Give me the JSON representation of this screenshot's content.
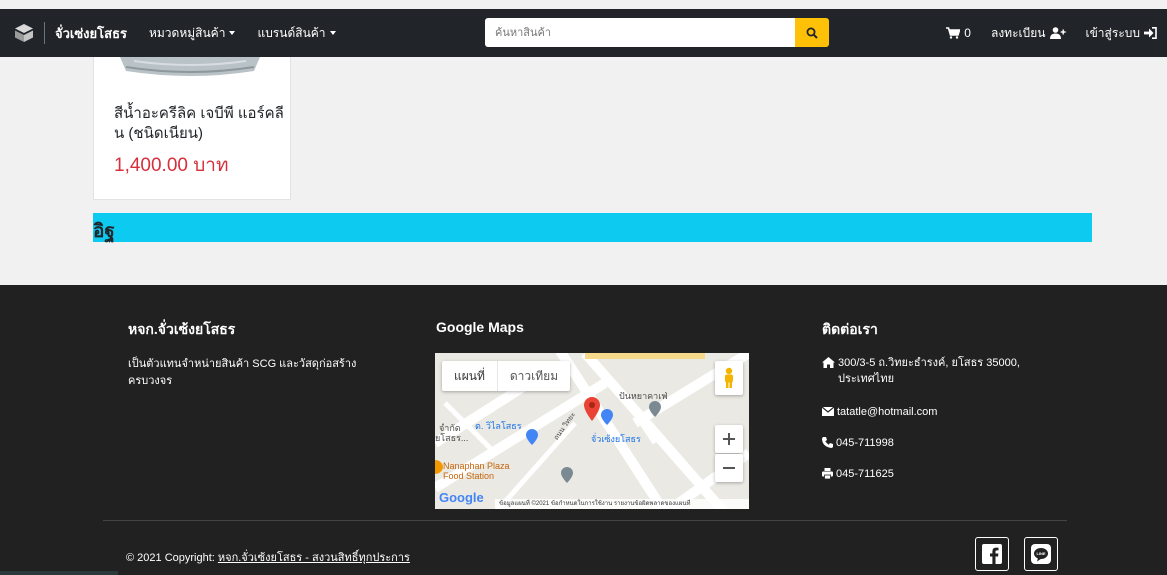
{
  "navbar": {
    "brand": "จั่วเซ่งยโสธร",
    "categories_label": "หมวดหมู่สินค้า",
    "brands_label": "แบรนด์สินค้า",
    "search_placeholder": "ค้นหาสินค้า",
    "cart_count": "0",
    "register_label": "ลงทะเบียน",
    "login_label": "เข้าสู่ระบบ"
  },
  "product": {
    "title": "สีน้ำอะครีลิค เจบีพี แอร์คลีน (ชนิดเนียน)",
    "price": "1,400.00 บาท"
  },
  "category": {
    "title": "อิฐ"
  },
  "footer": {
    "about": {
      "heading": "หจก.จั่วเซ้งยโสธร",
      "text": "เป็นตัวแทนจำหน่ายสินค้า SCG และวัสดุก่อสร้างครบวงจร"
    },
    "maps": {
      "heading": "Google Maps",
      "tab_map": "แผนที่",
      "tab_satellite": "ดาวเทียม",
      "labels": {
        "cafe": "ปันหยาคาเฟ่",
        "school": "ต. วิไลโสธร",
        "shop": "จั่วเซ้งยโสธร",
        "plaza_1": "Nanaphan Plaza",
        "plaza_2": "Food Station",
        "left_1": "จำกัด",
        "left_2": "ยโสธร...",
        "road": "ถนน วิทยะ",
        "google": "Google",
        "attribution": "ข้อมูลแผนที่ ©2021   ข้อกำหนดในการใช้งาน   รายงานข้อผิดพลาดของแผนที่"
      }
    },
    "contact": {
      "heading": "ติดต่อเรา",
      "address": "300/3-5 ถ.วิทยะธำรงค์, ยโสธร 35000, ประเทศไทย",
      "email": "tatatle@hotmail.com",
      "phone": "045-711998",
      "fax": "045-711625"
    },
    "copyright_prefix": "© 2021 Copyright: ",
    "copyright_link": "หจก.จั่วเซ้งยโสธร - สงวนสิทธิ์ทุกประการ"
  },
  "colors": {
    "navbar": "#212529",
    "search_button": "#ffc107",
    "price": "#d6303c",
    "category_bar": "#0dcaf0",
    "footer": "#212121"
  }
}
